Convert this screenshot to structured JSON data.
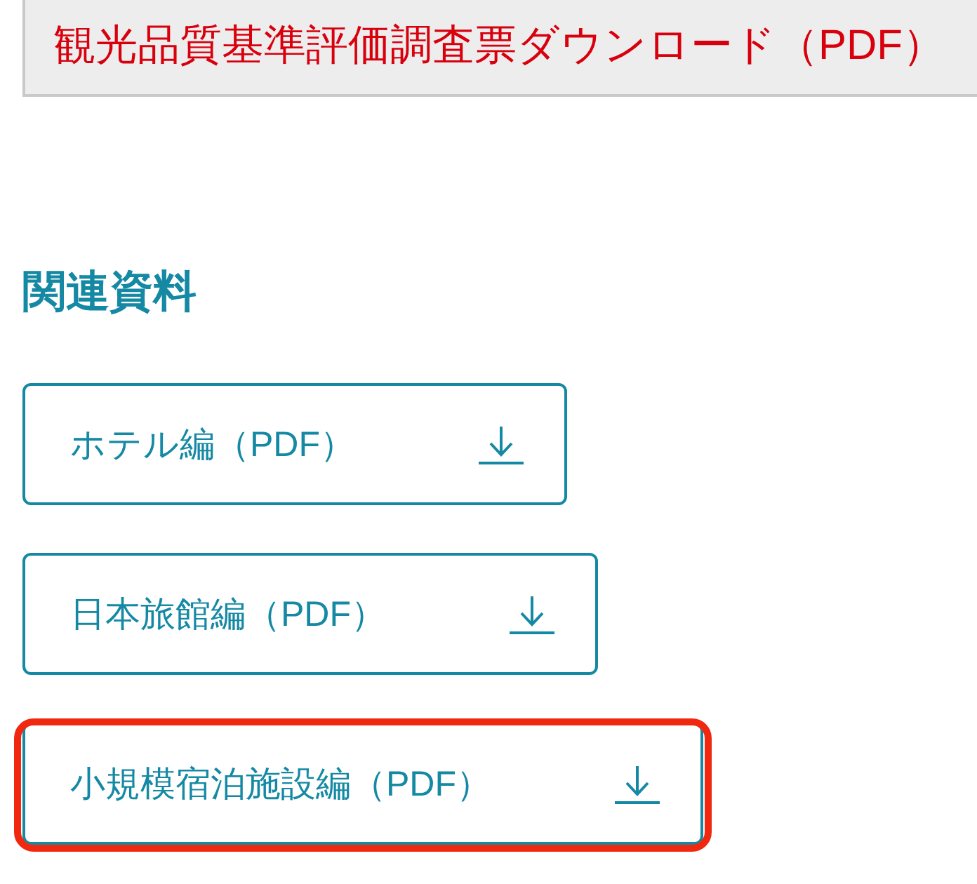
{
  "page_heading": {
    "text": "観光品質基準評価調査票ダウンロード（PDF）"
  },
  "related": {
    "heading": "関連資料",
    "links": [
      {
        "label": "ホテル編（PDF）",
        "highlighted": false
      },
      {
        "label": "日本旅館編（PDF）",
        "highlighted": false
      },
      {
        "label": "小規模宿泊施設編（PDF）",
        "highlighted": true
      }
    ]
  }
}
